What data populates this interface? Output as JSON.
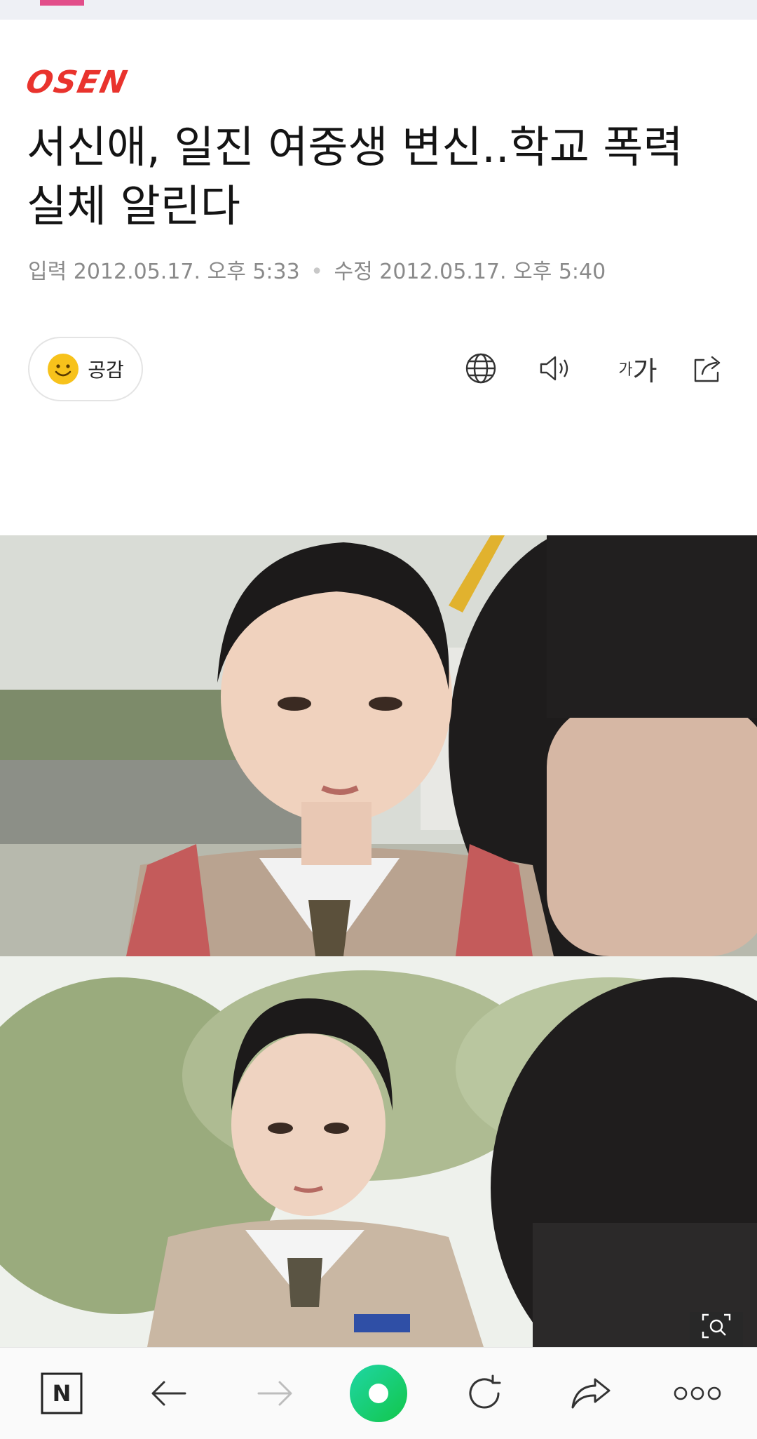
{
  "top_accent_color": "#e24e8a",
  "brand": {
    "logo_text": "OSEN",
    "color": "#e9332d"
  },
  "article": {
    "title": "서신애, 일진 여중생 변신..학교 폭력 실체 알린다",
    "input_label": "입력",
    "input_date": "2012.05.17. 오후 5:33",
    "separator": "•",
    "modified_label": "수정",
    "modified_date": "2012.05.17. 오후 5:40"
  },
  "actions": {
    "empathy_label": "공감",
    "empathy_icon": "smiley-face-icon",
    "font_small": "가",
    "font_large": "가",
    "tools": [
      "globe-icon",
      "speaker-icon",
      "font-size-icon",
      "share-icon"
    ]
  },
  "image": {
    "description_icon": "image-search-icon"
  },
  "bottom_nav": {
    "items": [
      "naver-home-icon",
      "back-icon",
      "forward-icon",
      "green-dot-icon",
      "refresh-icon",
      "share-forward-icon",
      "more-icon"
    ],
    "home_letter": "N",
    "green_color": "#19ce60"
  }
}
